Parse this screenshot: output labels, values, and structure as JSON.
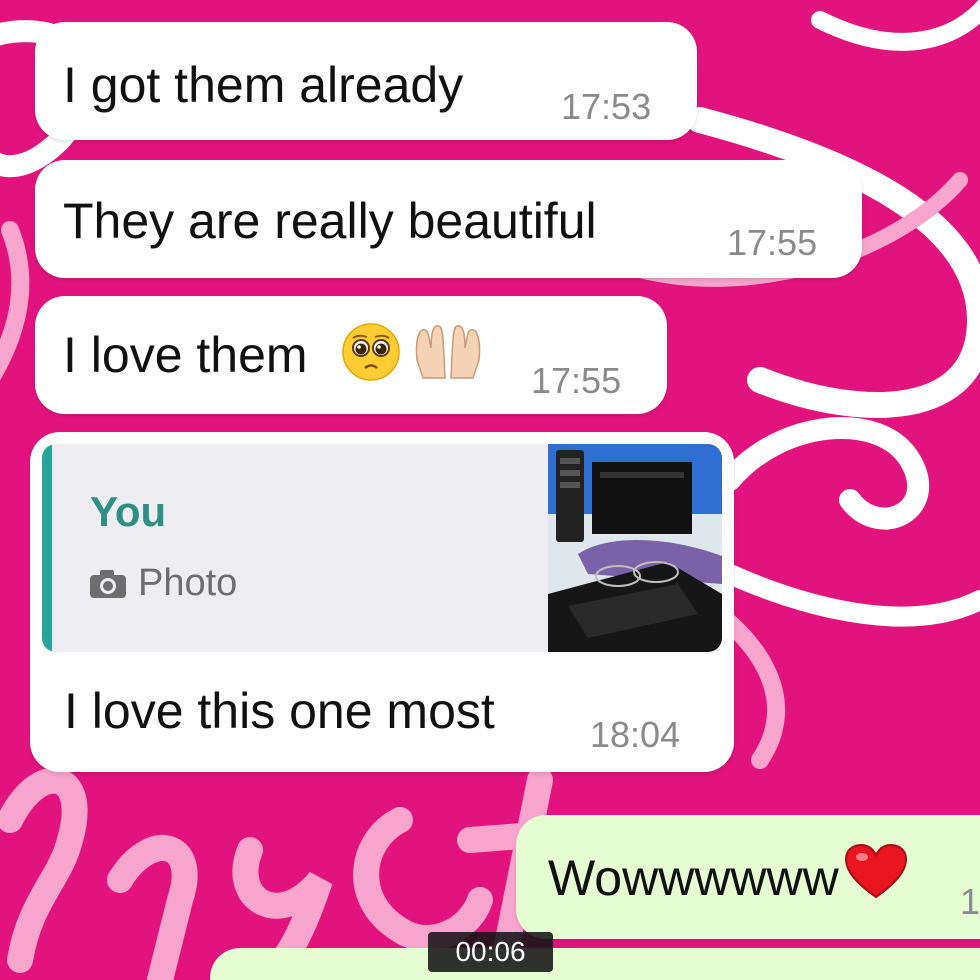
{
  "colors": {
    "background": "#e3137e",
    "incoming_bubble": "#ffffff",
    "outgoing_bubble": "#e5fbd2",
    "quote_accent": "#26a69a"
  },
  "messages": [
    {
      "direction": "incoming",
      "text": "I got them already",
      "time": "17:53"
    },
    {
      "direction": "incoming",
      "text": "They are really beautiful",
      "time": "17:55"
    },
    {
      "direction": "incoming",
      "text": "I love them",
      "emojis": [
        "pleading-face-emoji",
        "palms-up-together-emoji"
      ],
      "time": "17:55"
    },
    {
      "direction": "incoming",
      "quote": {
        "author": "You",
        "type_label": "Photo",
        "icon": "camera-icon",
        "thumbnail": "photo-thumbnail"
      },
      "text": "I love this one most",
      "time": "18:04"
    },
    {
      "direction": "outgoing",
      "text": "Wowwwwww",
      "emojis": [
        "red-heart-emoji"
      ],
      "time": "1"
    }
  ],
  "video_timer": "00:06"
}
